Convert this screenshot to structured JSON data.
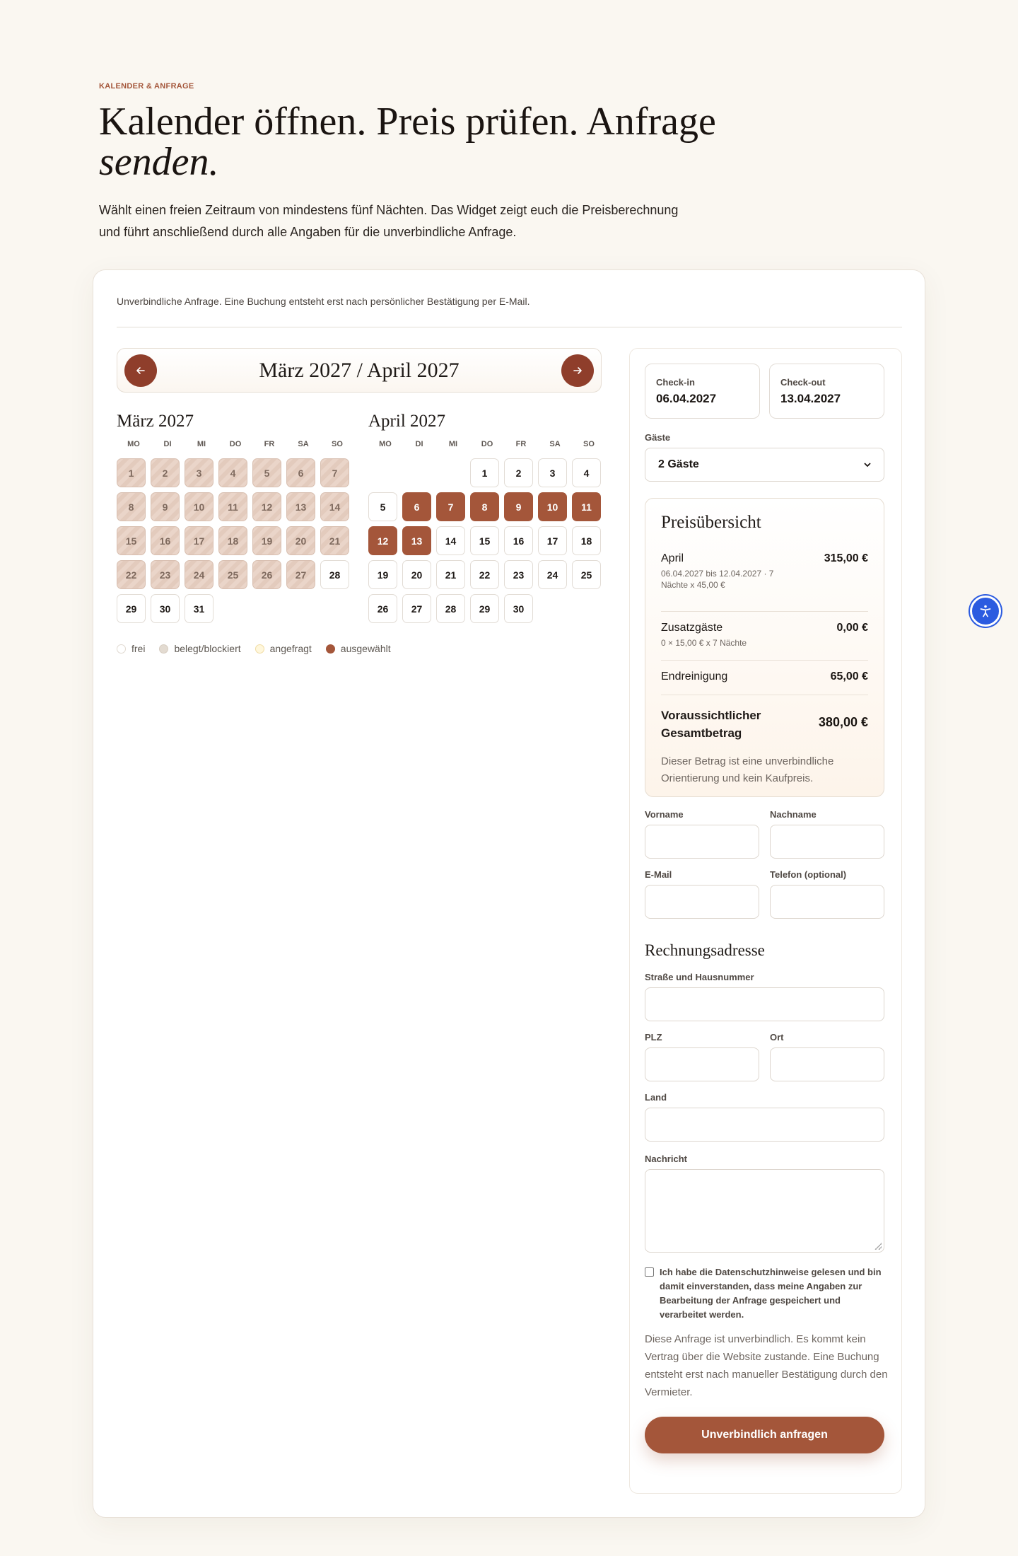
{
  "hero": {
    "eyebrow": "KALENDER & ANFRAGE",
    "title_line1": "Kalender öffnen. Preis prüfen. Anfrage",
    "title_line2": "senden.",
    "intro": "Wählt einen freien Zeitraum von mindestens fünf Nächten. Das Widget zeigt euch die Preisberechnung und führt anschließend durch alle Angaben für die unverbindliche Anfrage."
  },
  "card": {
    "note": "Unverbindliche Anfrage. Eine Buchung entsteht erst nach persönlicher Bestätigung per E-Mail."
  },
  "calendar": {
    "nav_title": "März 2027 / April 2027",
    "prev_icon": "arrow-left-icon",
    "next_icon": "arrow-right-icon",
    "weekdays": [
      "MO",
      "DI",
      "MI",
      "DO",
      "FR",
      "SA",
      "SO"
    ],
    "months": [
      {
        "title": "März 2027",
        "offset": 0,
        "days": [
          {
            "d": "1",
            "s": "blocked"
          },
          {
            "d": "2",
            "s": "blocked"
          },
          {
            "d": "3",
            "s": "blocked"
          },
          {
            "d": "4",
            "s": "blocked"
          },
          {
            "d": "5",
            "s": "blocked"
          },
          {
            "d": "6",
            "s": "blocked"
          },
          {
            "d": "7",
            "s": "blocked"
          },
          {
            "d": "8",
            "s": "blocked"
          },
          {
            "d": "9",
            "s": "blocked"
          },
          {
            "d": "10",
            "s": "blocked"
          },
          {
            "d": "11",
            "s": "blocked"
          },
          {
            "d": "12",
            "s": "blocked"
          },
          {
            "d": "13",
            "s": "blocked"
          },
          {
            "d": "14",
            "s": "blocked"
          },
          {
            "d": "15",
            "s": "blocked"
          },
          {
            "d": "16",
            "s": "blocked"
          },
          {
            "d": "17",
            "s": "blocked"
          },
          {
            "d": "18",
            "s": "blocked"
          },
          {
            "d": "19",
            "s": "blocked"
          },
          {
            "d": "20",
            "s": "blocked"
          },
          {
            "d": "21",
            "s": "blocked"
          },
          {
            "d": "22",
            "s": "blocked"
          },
          {
            "d": "23",
            "s": "blocked"
          },
          {
            "d": "24",
            "s": "blocked"
          },
          {
            "d": "25",
            "s": "blocked"
          },
          {
            "d": "26",
            "s": "blocked"
          },
          {
            "d": "27",
            "s": "blocked"
          },
          {
            "d": "28",
            "s": "free"
          },
          {
            "d": "29",
            "s": "free"
          },
          {
            "d": "30",
            "s": "free"
          },
          {
            "d": "31",
            "s": "free"
          }
        ]
      },
      {
        "title": "April 2027",
        "offset": 3,
        "days": [
          {
            "d": "1",
            "s": "free"
          },
          {
            "d": "2",
            "s": "free"
          },
          {
            "d": "3",
            "s": "free"
          },
          {
            "d": "4",
            "s": "free"
          },
          {
            "d": "5",
            "s": "free"
          },
          {
            "d": "6",
            "s": "selected"
          },
          {
            "d": "7",
            "s": "selected"
          },
          {
            "d": "8",
            "s": "selected"
          },
          {
            "d": "9",
            "s": "selected"
          },
          {
            "d": "10",
            "s": "selected"
          },
          {
            "d": "11",
            "s": "selected"
          },
          {
            "d": "12",
            "s": "selected"
          },
          {
            "d": "13",
            "s": "selected"
          },
          {
            "d": "14",
            "s": "free"
          },
          {
            "d": "15",
            "s": "free"
          },
          {
            "d": "16",
            "s": "free"
          },
          {
            "d": "17",
            "s": "free"
          },
          {
            "d": "18",
            "s": "free"
          },
          {
            "d": "19",
            "s": "free"
          },
          {
            "d": "20",
            "s": "free"
          },
          {
            "d": "21",
            "s": "free"
          },
          {
            "d": "22",
            "s": "free"
          },
          {
            "d": "23",
            "s": "free"
          },
          {
            "d": "24",
            "s": "free"
          },
          {
            "d": "25",
            "s": "free"
          },
          {
            "d": "26",
            "s": "free"
          },
          {
            "d": "27",
            "s": "free"
          },
          {
            "d": "28",
            "s": "free"
          },
          {
            "d": "29",
            "s": "free"
          },
          {
            "d": "30",
            "s": "free"
          }
        ]
      }
    ],
    "legend": {
      "free": "frei",
      "blocked": "belegt/blockiert",
      "requested": "angefragt",
      "selected": "ausgewählt"
    }
  },
  "booking": {
    "checkin_label": "Check-in",
    "checkin_value": "06.04.2027",
    "checkout_label": "Check-out",
    "checkout_value": "13.04.2027",
    "guests_label": "Gäste",
    "guests_value": "2 Gäste"
  },
  "price": {
    "title": "Preisübersicht",
    "rows": [
      {
        "label": "April",
        "sub": "06.04.2027 bis 12.04.2027 · 7 Nächte x 45,00 €",
        "amount": "315,00 €"
      },
      {
        "label": "Zusatzgäste",
        "sub": "0 × 15,00 € x 7 Nächte",
        "amount": "0,00 €"
      },
      {
        "label": "Endreinigung",
        "sub": "",
        "amount": "65,00 €"
      },
      {
        "label": "Voraussichtlicher Gesamtbetrag",
        "sub": "",
        "amount": "380,00 €"
      }
    ],
    "note": "Dieser Betrag ist eine unverbindliche Orientierung und kein Kaufpreis."
  },
  "form": {
    "firstname_label": "Vorname",
    "lastname_label": "Nachname",
    "email_label": "E-Mail",
    "phone_label": "Telefon (optional)",
    "billing_title": "Rechnungsadresse",
    "street_label": "Straße und Hausnummer",
    "zip_label": "PLZ",
    "city_label": "Ort",
    "country_label": "Land",
    "message_label": "Nachricht",
    "consent": "Ich habe die Datenschutzhinweise gelesen und bin damit einverstanden, dass meine Angaben zur Bearbeitung der Anfrage gespeichert und verarbeitet werden.",
    "disclaimer": "Diese Anfrage ist unverbindlich. Es kommt kein Vertrag über die Website zustande. Eine Buchung entsteht erst nach manueller Bestätigung durch den Vermieter.",
    "submit": "Unverbindlich anfragen"
  },
  "accessibility_icon": "accessibility-icon",
  "colors": {
    "accent": "#a4563a",
    "accent_dark": "#8f3e2b",
    "background": "#faf7f1",
    "a11y": "#2b5be0"
  }
}
